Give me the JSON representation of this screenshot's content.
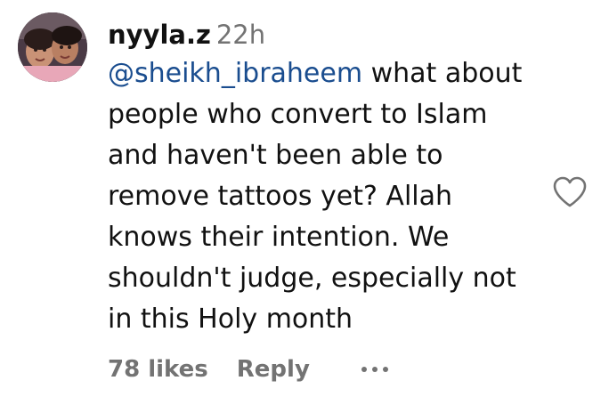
{
  "comment": {
    "username": "nyyla.z",
    "time": "22h",
    "mention": "@sheikh_ibraheem",
    "lines": [
      " what about",
      "people who convert to Islam",
      "and haven't been able to",
      "remove tattoos yet? Allah",
      "knows their intention. We",
      "shouldn't judge, especially not",
      "in this Holy month"
    ],
    "likes": "78 likes",
    "reply": "Reply"
  },
  "icons": {
    "avatar": "profile-photo",
    "heart": "heart-outline-icon",
    "more": "more-options-icon"
  },
  "colors": {
    "mention": "#1a4d8f",
    "muted": "#737373",
    "text": "#111111"
  }
}
